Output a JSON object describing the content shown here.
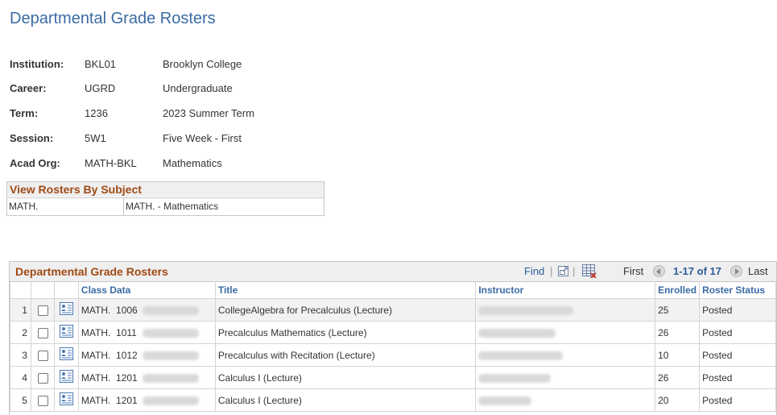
{
  "page": {
    "title": "Departmental Grade Rosters"
  },
  "info": [
    {
      "label": "Institution:",
      "code": "BKL01",
      "desc": "Brooklyn College"
    },
    {
      "label": "Career:",
      "code": "UGRD",
      "desc": "Undergraduate"
    },
    {
      "label": "Term:",
      "code": "1236",
      "desc": "2023 Summer Term"
    },
    {
      "label": "Session:",
      "code": "5W1",
      "desc": "Five Week - First"
    },
    {
      "label": "Acad Org:",
      "code": "MATH-BKL",
      "desc": "Mathematics"
    }
  ],
  "subject": {
    "header": "View Rosters By Subject",
    "code": "MATH.",
    "desc": "MATH. - Mathematics"
  },
  "grid": {
    "title": "Departmental Grade Rosters",
    "find": "Find",
    "first": "First",
    "range": "1-17 of 17",
    "last": "Last",
    "columns": {
      "class_data": "Class Data",
      "title": "Title",
      "instructor": "Instructor",
      "enrolled": "Enrolled",
      "status": "Roster Status"
    },
    "rows": [
      {
        "num": "1",
        "subject": "MATH.",
        "catalog": "1006",
        "title": "CollegeAlgebra for Precalculus (Lecture)",
        "enrolled": "25",
        "status": "Posted"
      },
      {
        "num": "2",
        "subject": "MATH.",
        "catalog": "1011",
        "title": "Precalculus Mathematics (Lecture)",
        "enrolled": "26",
        "status": "Posted"
      },
      {
        "num": "3",
        "subject": "MATH.",
        "catalog": "1012",
        "title": "Precalculus with Recitation (Lecture)",
        "enrolled": "10",
        "status": "Posted"
      },
      {
        "num": "4",
        "subject": "MATH.",
        "catalog": "1201",
        "title": "Calculus I (Lecture)",
        "enrolled": "26",
        "status": "Posted"
      },
      {
        "num": "5",
        "subject": "MATH.",
        "catalog": "1201",
        "title": "Calculus I (Lecture)",
        "enrolled": "20",
        "status": "Posted"
      }
    ]
  },
  "colors": {
    "title_blue": "#3b6ba5",
    "section_orange": "#a04a14",
    "link_blue": "#2a5b9a"
  },
  "icons": [
    "zoom-icon",
    "download-grid-icon",
    "prev-circle-icon",
    "next-circle-icon",
    "roster-view-icon"
  ]
}
